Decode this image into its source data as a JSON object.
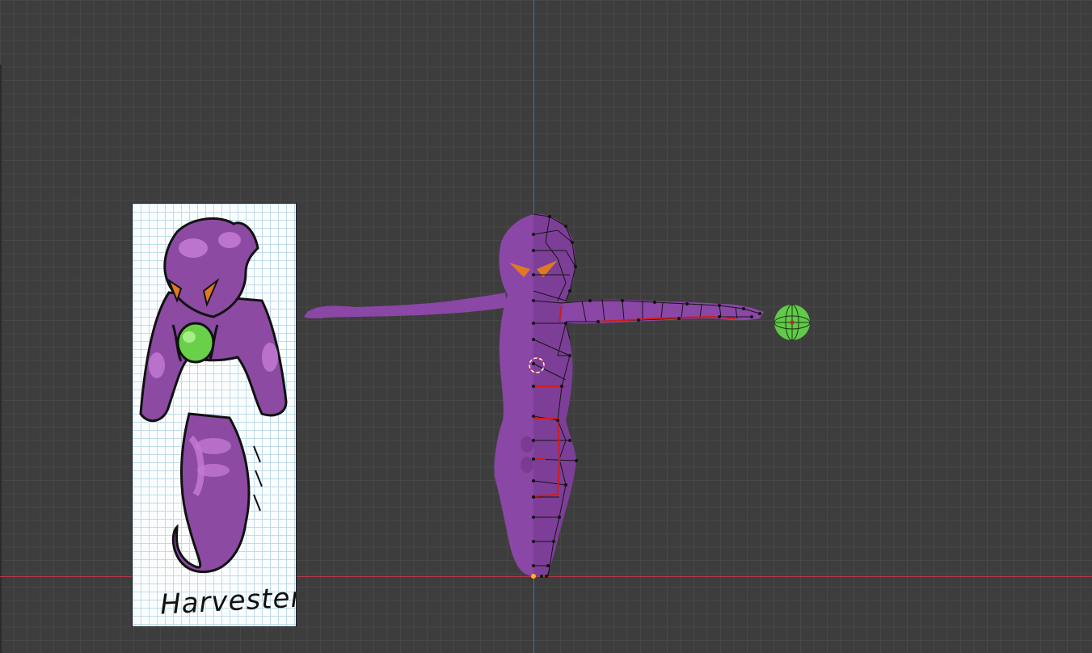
{
  "reference_image": {
    "caption": "Harvester"
  },
  "colors": {
    "background": "#3d3d3d",
    "grid": "#484848",
    "x_axis": "#b33a48",
    "y_axis": "#3b74c0",
    "mesh_body": "#8a47a6",
    "eyes": "#e07a22",
    "orb": "#62c94a",
    "seam_edges": "#d21c1c",
    "vertices": "#111111"
  },
  "icons": {
    "origin": "origin-point-icon",
    "cursor": "3d-cursor-icon"
  }
}
